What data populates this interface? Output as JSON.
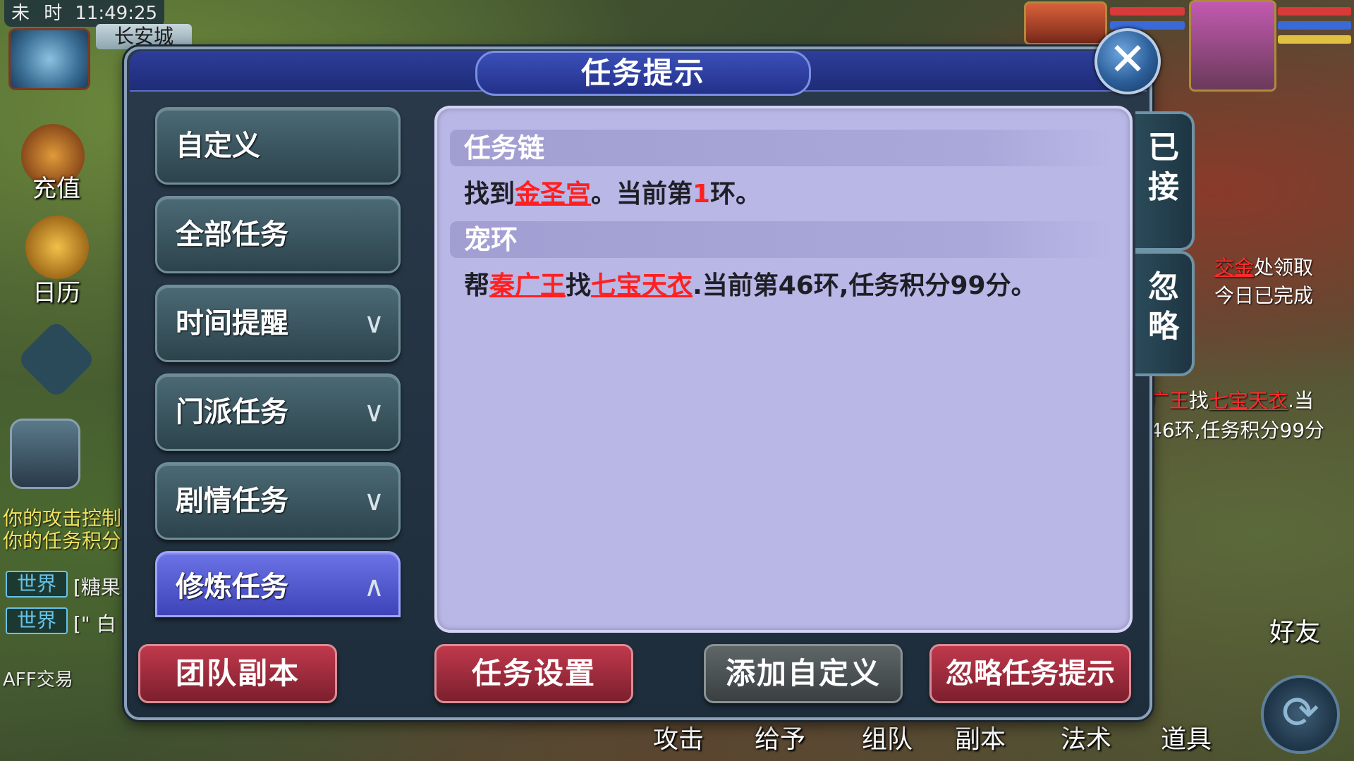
{
  "hud": {
    "shichen": "未 时",
    "clock": "11:49:25",
    "city": "长安城",
    "recharge_label": "充值",
    "calendar_label": "日历",
    "friends_label": "好友",
    "aff_label": "AFF交易"
  },
  "chat": {
    "line1": "你的攻击控制",
    "line2": "你的任务积分",
    "rows": [
      {
        "channel": "世界",
        "text": "[糖果"
      },
      {
        "channel": "世界",
        "text": "[\" 白"
      }
    ]
  },
  "right_quest": {
    "row1": "交金处领取",
    "row1_link": "交金",
    "row1_rest": "处领取",
    "row2": "今日已完成",
    "row3_pre": "广王",
    "row3_mid": "找",
    "row3_link": "七宝天衣",
    "row3_post": ".当",
    "row4": "46环,任务积分99分"
  },
  "bottom_bar": [
    "攻击",
    "给予",
    "组队",
    "副本",
    "法术",
    "道具"
  ],
  "dialog": {
    "title": "任务提示",
    "close_icon": "close-icon",
    "categories": [
      {
        "label": "自定义",
        "expandable": false
      },
      {
        "label": "全部任务",
        "expandable": false
      },
      {
        "label": "时间提醒",
        "expandable": true,
        "chevron": "∨"
      },
      {
        "label": "门派任务",
        "expandable": true,
        "chevron": "∨"
      },
      {
        "label": "剧情任务",
        "expandable": true,
        "chevron": "∨"
      },
      {
        "label": "修炼任务",
        "expandable": true,
        "chevron": "∧",
        "active": true
      }
    ],
    "side_tabs": [
      {
        "chars": [
          "已",
          "接"
        ]
      },
      {
        "chars": [
          "忽",
          "略"
        ]
      }
    ],
    "quests": [
      {
        "name": "任务链",
        "parts": [
          {
            "t": "找到",
            "style": "normal"
          },
          {
            "t": "金圣宫",
            "style": "link"
          },
          {
            "t": "。当前第",
            "style": "normal"
          },
          {
            "t": "1",
            "style": "num"
          },
          {
            "t": "环。",
            "style": "normal"
          }
        ]
      },
      {
        "name": "宠环",
        "parts": [
          {
            "t": "帮",
            "style": "normal"
          },
          {
            "t": "秦广王",
            "style": "link"
          },
          {
            "t": "找",
            "style": "normal"
          },
          {
            "t": "七宝天衣",
            "style": "link"
          },
          {
            "t": ".当前第46环,任务积分99分。",
            "style": "normal"
          }
        ]
      }
    ],
    "buttons": {
      "team_dungeon": "团队副本",
      "task_settings": "任务设置",
      "add_custom": "添加自定义",
      "ignore_prompt": "忽略任务提示"
    }
  },
  "colors": {
    "content_bg": "#b9b7e6",
    "active_tab": "#5a60d6",
    "red_button": "#9c2c3c",
    "highlight": "#ff2020"
  }
}
